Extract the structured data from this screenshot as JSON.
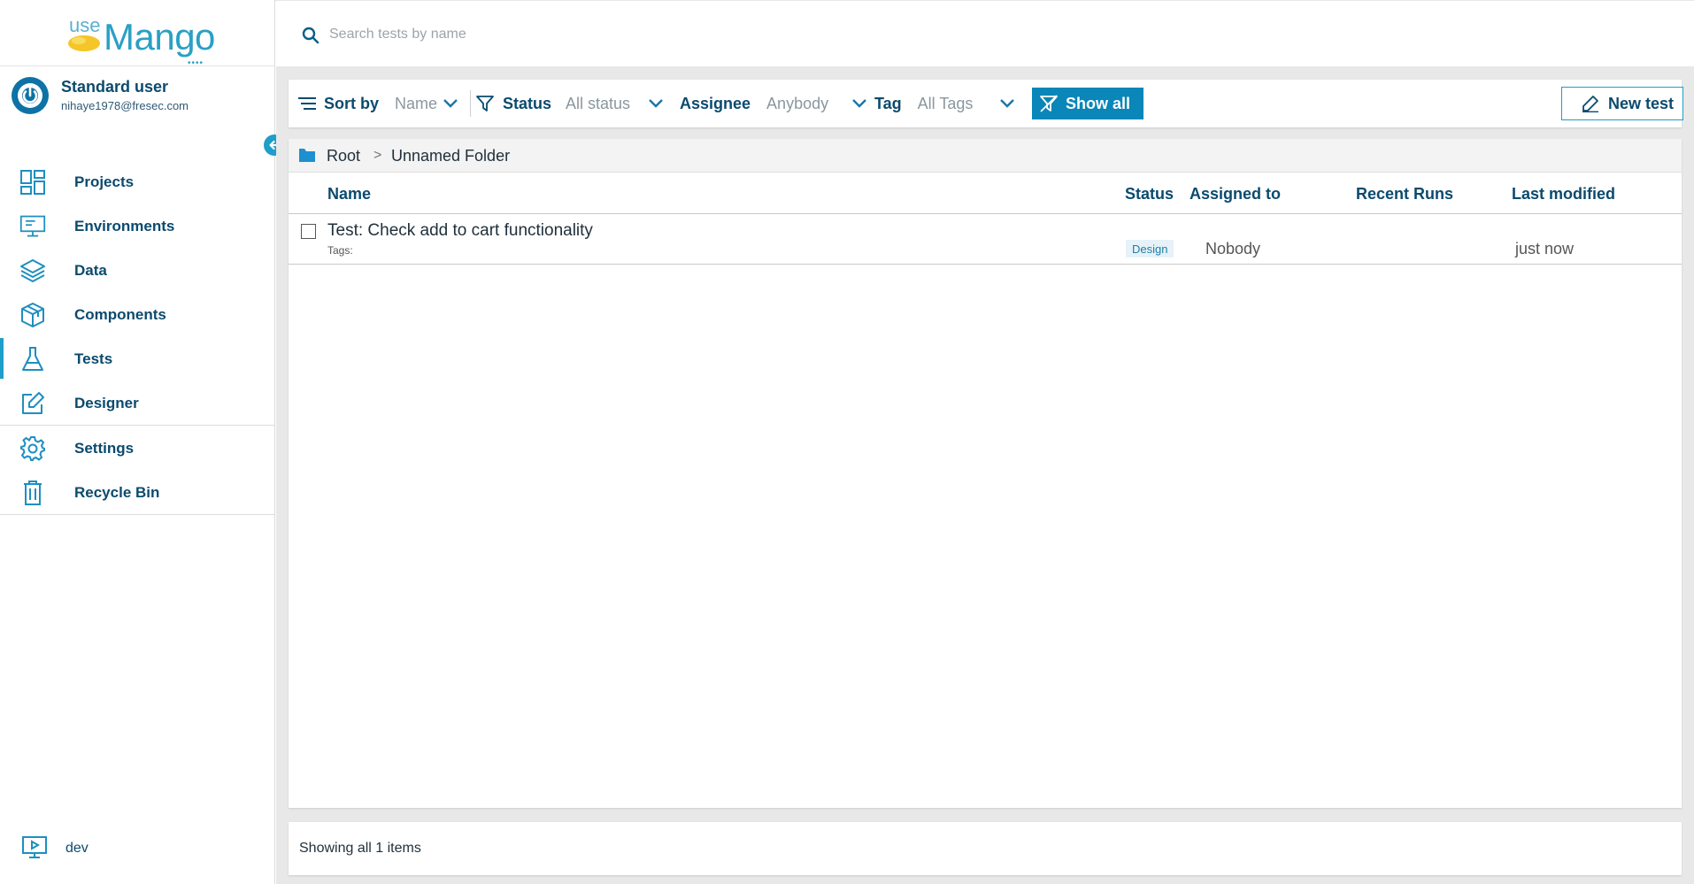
{
  "app": {
    "brand_use": "use",
    "brand_mango": "Mango",
    "brand_dots": "••••"
  },
  "user": {
    "name": "Standard user",
    "email": "nihaye1978@fresec.com"
  },
  "sidebar": {
    "items": [
      {
        "label": "Projects",
        "icon": "projects-grid-icon"
      },
      {
        "label": "Environments",
        "icon": "monitor-icon"
      },
      {
        "label": "Data",
        "icon": "layers-icon"
      },
      {
        "label": "Components",
        "icon": "cube-icon"
      },
      {
        "label": "Tests",
        "icon": "flask-icon",
        "active": true
      },
      {
        "label": "Designer",
        "icon": "edit-icon"
      },
      {
        "label": "Settings",
        "icon": "gear-icon"
      },
      {
        "label": "Recycle Bin",
        "icon": "trash-icon"
      }
    ],
    "environment": "dev"
  },
  "search": {
    "placeholder": "Search tests by name",
    "value": ""
  },
  "toolbar": {
    "sort_label": "Sort by",
    "sort_value": "Name",
    "status_label": "Status",
    "status_value": "All status",
    "assignee_label": "Assignee",
    "assignee_value": "Anybody",
    "tag_label": "Tag",
    "tag_value": "All Tags",
    "show_all": "Show all",
    "new_test": "New test"
  },
  "breadcrumb": {
    "root": "Root",
    "separator": ">",
    "current": "Unnamed Folder"
  },
  "table": {
    "columns": {
      "name": "Name",
      "status": "Status",
      "assigned": "Assigned to",
      "recent_runs": "Recent Runs",
      "last_modified": "Last modified"
    },
    "rows": [
      {
        "name": "Test: Check add to cart functionality",
        "tags_label": "Tags:",
        "status": "Design",
        "assigned": "Nobody",
        "recent_runs": "",
        "last_modified": "just now"
      }
    ]
  },
  "footer": {
    "summary": "Showing all 1 items"
  },
  "colors": {
    "accent": "#1e9ec8",
    "primary_button": "#0a86b8",
    "nav_text": "#0b4a6e"
  }
}
